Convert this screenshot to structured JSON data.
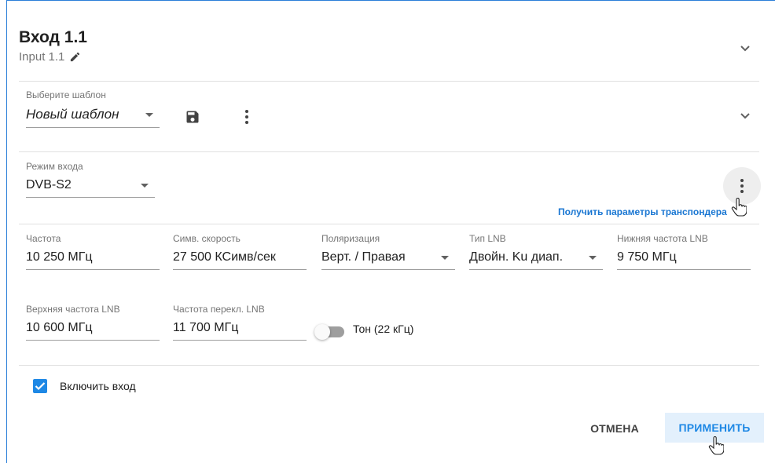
{
  "header": {
    "title": "Вход 1.1",
    "subtitle": "Input 1.1"
  },
  "template": {
    "label": "Выберите шаблон",
    "value": "Новый шаблон"
  },
  "mode": {
    "label": "Режим входа",
    "value": "DVB-S2",
    "transponder_link": "Получить параметры транспондера"
  },
  "params": {
    "frequency": {
      "label": "Частота",
      "value": "10 250 МГц"
    },
    "symbol_rate": {
      "label": "Симв. скорость",
      "value": "27 500 КСимв/сек"
    },
    "polarization": {
      "label": "Поляризация",
      "value": "Верт. / Правая"
    },
    "lnb_type": {
      "label": "Тип LNB",
      "value": "Двойн. Ku диап."
    },
    "lnb_low": {
      "label": "Нижняя частота LNB",
      "value": "9 750 МГц"
    },
    "lnb_high": {
      "label": "Верхняя частота LNB",
      "value": "10 600 МГц"
    },
    "lnb_switch": {
      "label": "Частота перекл. LNB",
      "value": "11 700 МГц"
    },
    "tone": {
      "label": "Тон (22 кГц)",
      "enabled": false
    }
  },
  "enable": {
    "label": "Включить вход",
    "checked": true
  },
  "actions": {
    "cancel": "ОТМЕНА",
    "apply": "ПРИМЕНИТЬ"
  },
  "colors": {
    "accent": "#1e88e5",
    "link": "#1976d2",
    "frame": "#2b7fd9"
  }
}
